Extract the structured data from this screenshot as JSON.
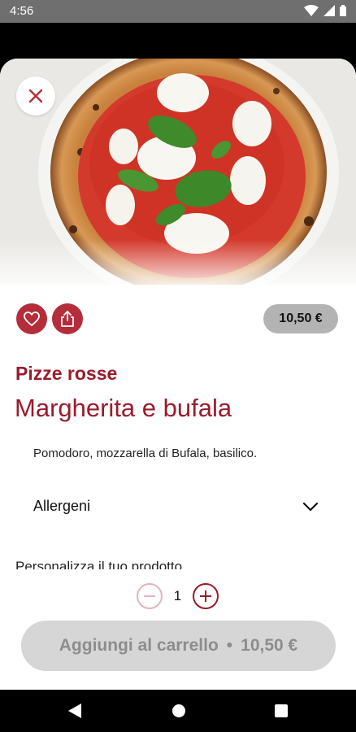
{
  "status_bar": {
    "time": "4:56"
  },
  "product": {
    "category": "Pizze rosse",
    "name": "Margherita e bufala",
    "description": "Pomodoro, mozzarella di Bufala, basilico.",
    "price": "10,50 €"
  },
  "allergens": {
    "label": "Allergeni"
  },
  "personalize": {
    "label": "Personalizza il tuo prodotto"
  },
  "quantity": {
    "value": "1"
  },
  "cart_button": {
    "label": "Aggiungi al carrello",
    "separator": "•",
    "price": "10,50 €"
  },
  "colors": {
    "brand": "#9a1b2b",
    "button_disabled": "#d6d6d6",
    "price_pill": "#b3b3b3"
  },
  "icons": [
    "wifi-icon",
    "signal-icon",
    "battery-icon",
    "close-icon",
    "heart-icon",
    "share-icon",
    "chevron-down-icon",
    "minus-icon",
    "plus-icon",
    "back-icon",
    "home-icon",
    "recents-icon"
  ]
}
